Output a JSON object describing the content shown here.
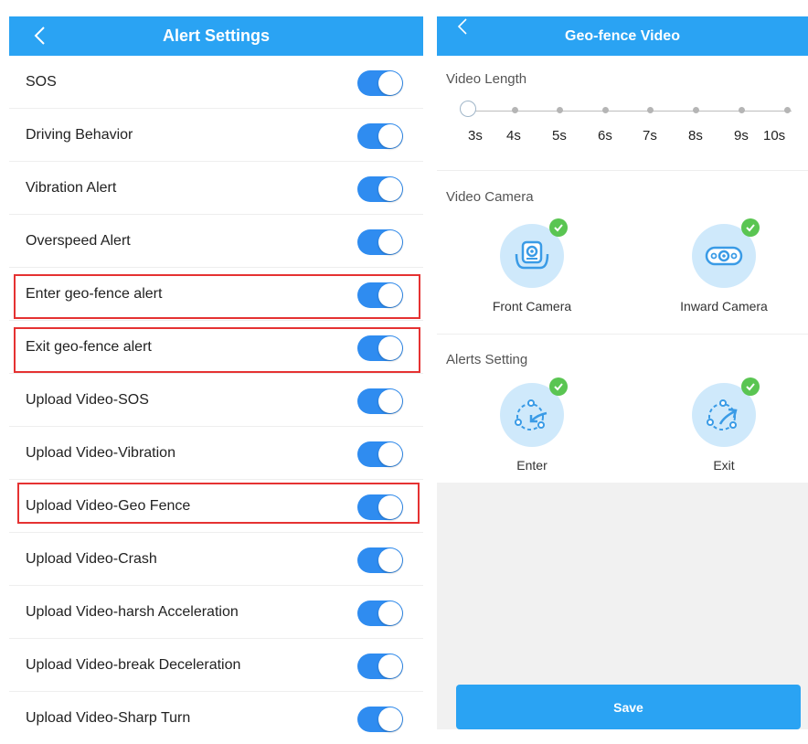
{
  "left": {
    "title": "Alert Settings",
    "items": [
      {
        "label": "SOS",
        "on": true
      },
      {
        "label": "Driving Behavior",
        "on": true
      },
      {
        "label": "Vibration Alert",
        "on": true
      },
      {
        "label": "Overspeed Alert",
        "on": true
      },
      {
        "label": "Enter geo-fence alert",
        "on": true
      },
      {
        "label": "Exit geo-fence alert",
        "on": true
      },
      {
        "label": "Upload Video-SOS",
        "on": true
      },
      {
        "label": "Upload Video-Vibration",
        "on": true
      },
      {
        "label": "Upload Video-Geo Fence",
        "on": true
      },
      {
        "label": "Upload Video-Crash",
        "on": true
      },
      {
        "label": "Upload Video-harsh Acceleration",
        "on": true
      },
      {
        "label": "Upload Video-break Deceleration",
        "on": true
      },
      {
        "label": "Upload Video-Sharp Turn",
        "on": true
      }
    ]
  },
  "right": {
    "title": "Geo-fence Video",
    "video_length": {
      "title": "Video Length",
      "ticks": [
        "3s",
        "4s",
        "5s",
        "6s",
        "7s",
        "8s",
        "9s",
        "10s"
      ],
      "selected": "3s"
    },
    "video_camera": {
      "title": "Video Camera",
      "options": [
        {
          "label": "Front Camera",
          "checked": true
        },
        {
          "label": "Inward Camera",
          "checked": true
        }
      ]
    },
    "alerts_setting": {
      "title": "Alerts Setting",
      "options": [
        {
          "label": "Enter",
          "checked": true
        },
        {
          "label": "Exit",
          "checked": true
        }
      ]
    },
    "save_label": "Save"
  },
  "colors": {
    "header": "#2aa3f3",
    "toggle_on": "#2f8cf0",
    "highlight": "#e53232",
    "check": "#5ac552",
    "icon_bg": "#cfe9fb"
  }
}
